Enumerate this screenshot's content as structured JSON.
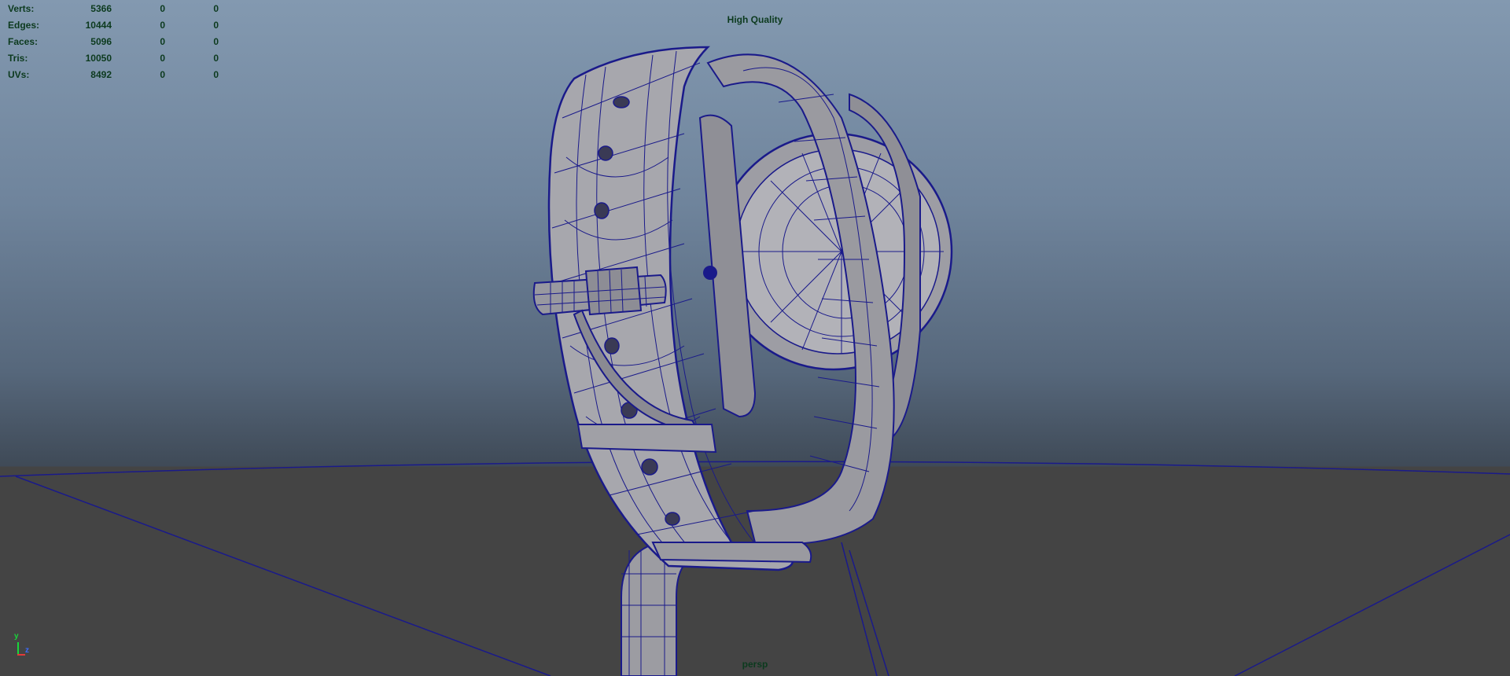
{
  "viewport": {
    "quality_label": "High Quality",
    "camera_label": "persp",
    "axis": {
      "y": "y",
      "z": "z"
    }
  },
  "hud": {
    "rows": [
      {
        "label": "Verts:",
        "v1": "5366",
        "v2": "0",
        "v3": "0"
      },
      {
        "label": "Edges:",
        "v1": "10444",
        "v2": "0",
        "v3": "0"
      },
      {
        "label": "Faces:",
        "v1": "5096",
        "v2": "0",
        "v3": "0"
      },
      {
        "label": "Tris:",
        "v1": "10050",
        "v2": "0",
        "v3": "0"
      },
      {
        "label": "UVs:",
        "v1": "8492",
        "v2": "0",
        "v3": "0"
      }
    ]
  },
  "colors": {
    "hud_text": "#0c3a1e",
    "wire": "#1a1a8a",
    "mesh": "#a3a3a8",
    "ground": "#444444"
  }
}
